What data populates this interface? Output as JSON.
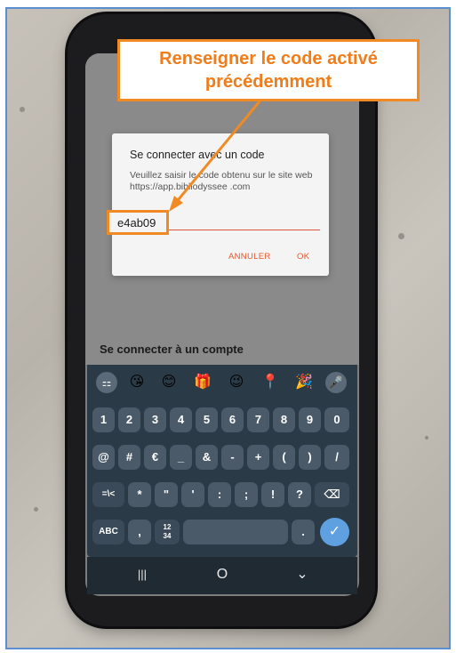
{
  "annotation": {
    "line1": "Renseigner le code activé",
    "line2": "précédemment"
  },
  "dialog": {
    "title": "Se connecter avec un code",
    "message": "Veuillez saisir le code obtenu sur le site web https://app.bibliodyssee .com",
    "code_value": "e4ab09",
    "cancel_label": "ANNULER",
    "ok_label": "OK"
  },
  "screen": {
    "account_title": "Se connecter à un compte"
  },
  "keyboard": {
    "emoji_row": [
      "⚏",
      "😘",
      "😊",
      "🎁",
      "😉",
      "📍",
      "🎉",
      "🎤"
    ],
    "row_numbers": [
      "1",
      "2",
      "3",
      "4",
      "5",
      "6",
      "7",
      "8",
      "9",
      "0"
    ],
    "row_symbols1": [
      "@",
      "#",
      "€",
      "_",
      "&",
      "-",
      "+",
      "(",
      ")",
      "/"
    ],
    "row_symbols2": [
      "=\\<",
      "*",
      "\"",
      "'",
      ":",
      ";",
      "!",
      "?",
      "⌫"
    ],
    "abc_label": "ABC",
    "comma_label": ",",
    "num_label": "12\n34",
    "period_label": ".",
    "enter_label": "✓"
  },
  "navbar": {
    "recents": "|||",
    "home": "O",
    "back": "⌄"
  }
}
